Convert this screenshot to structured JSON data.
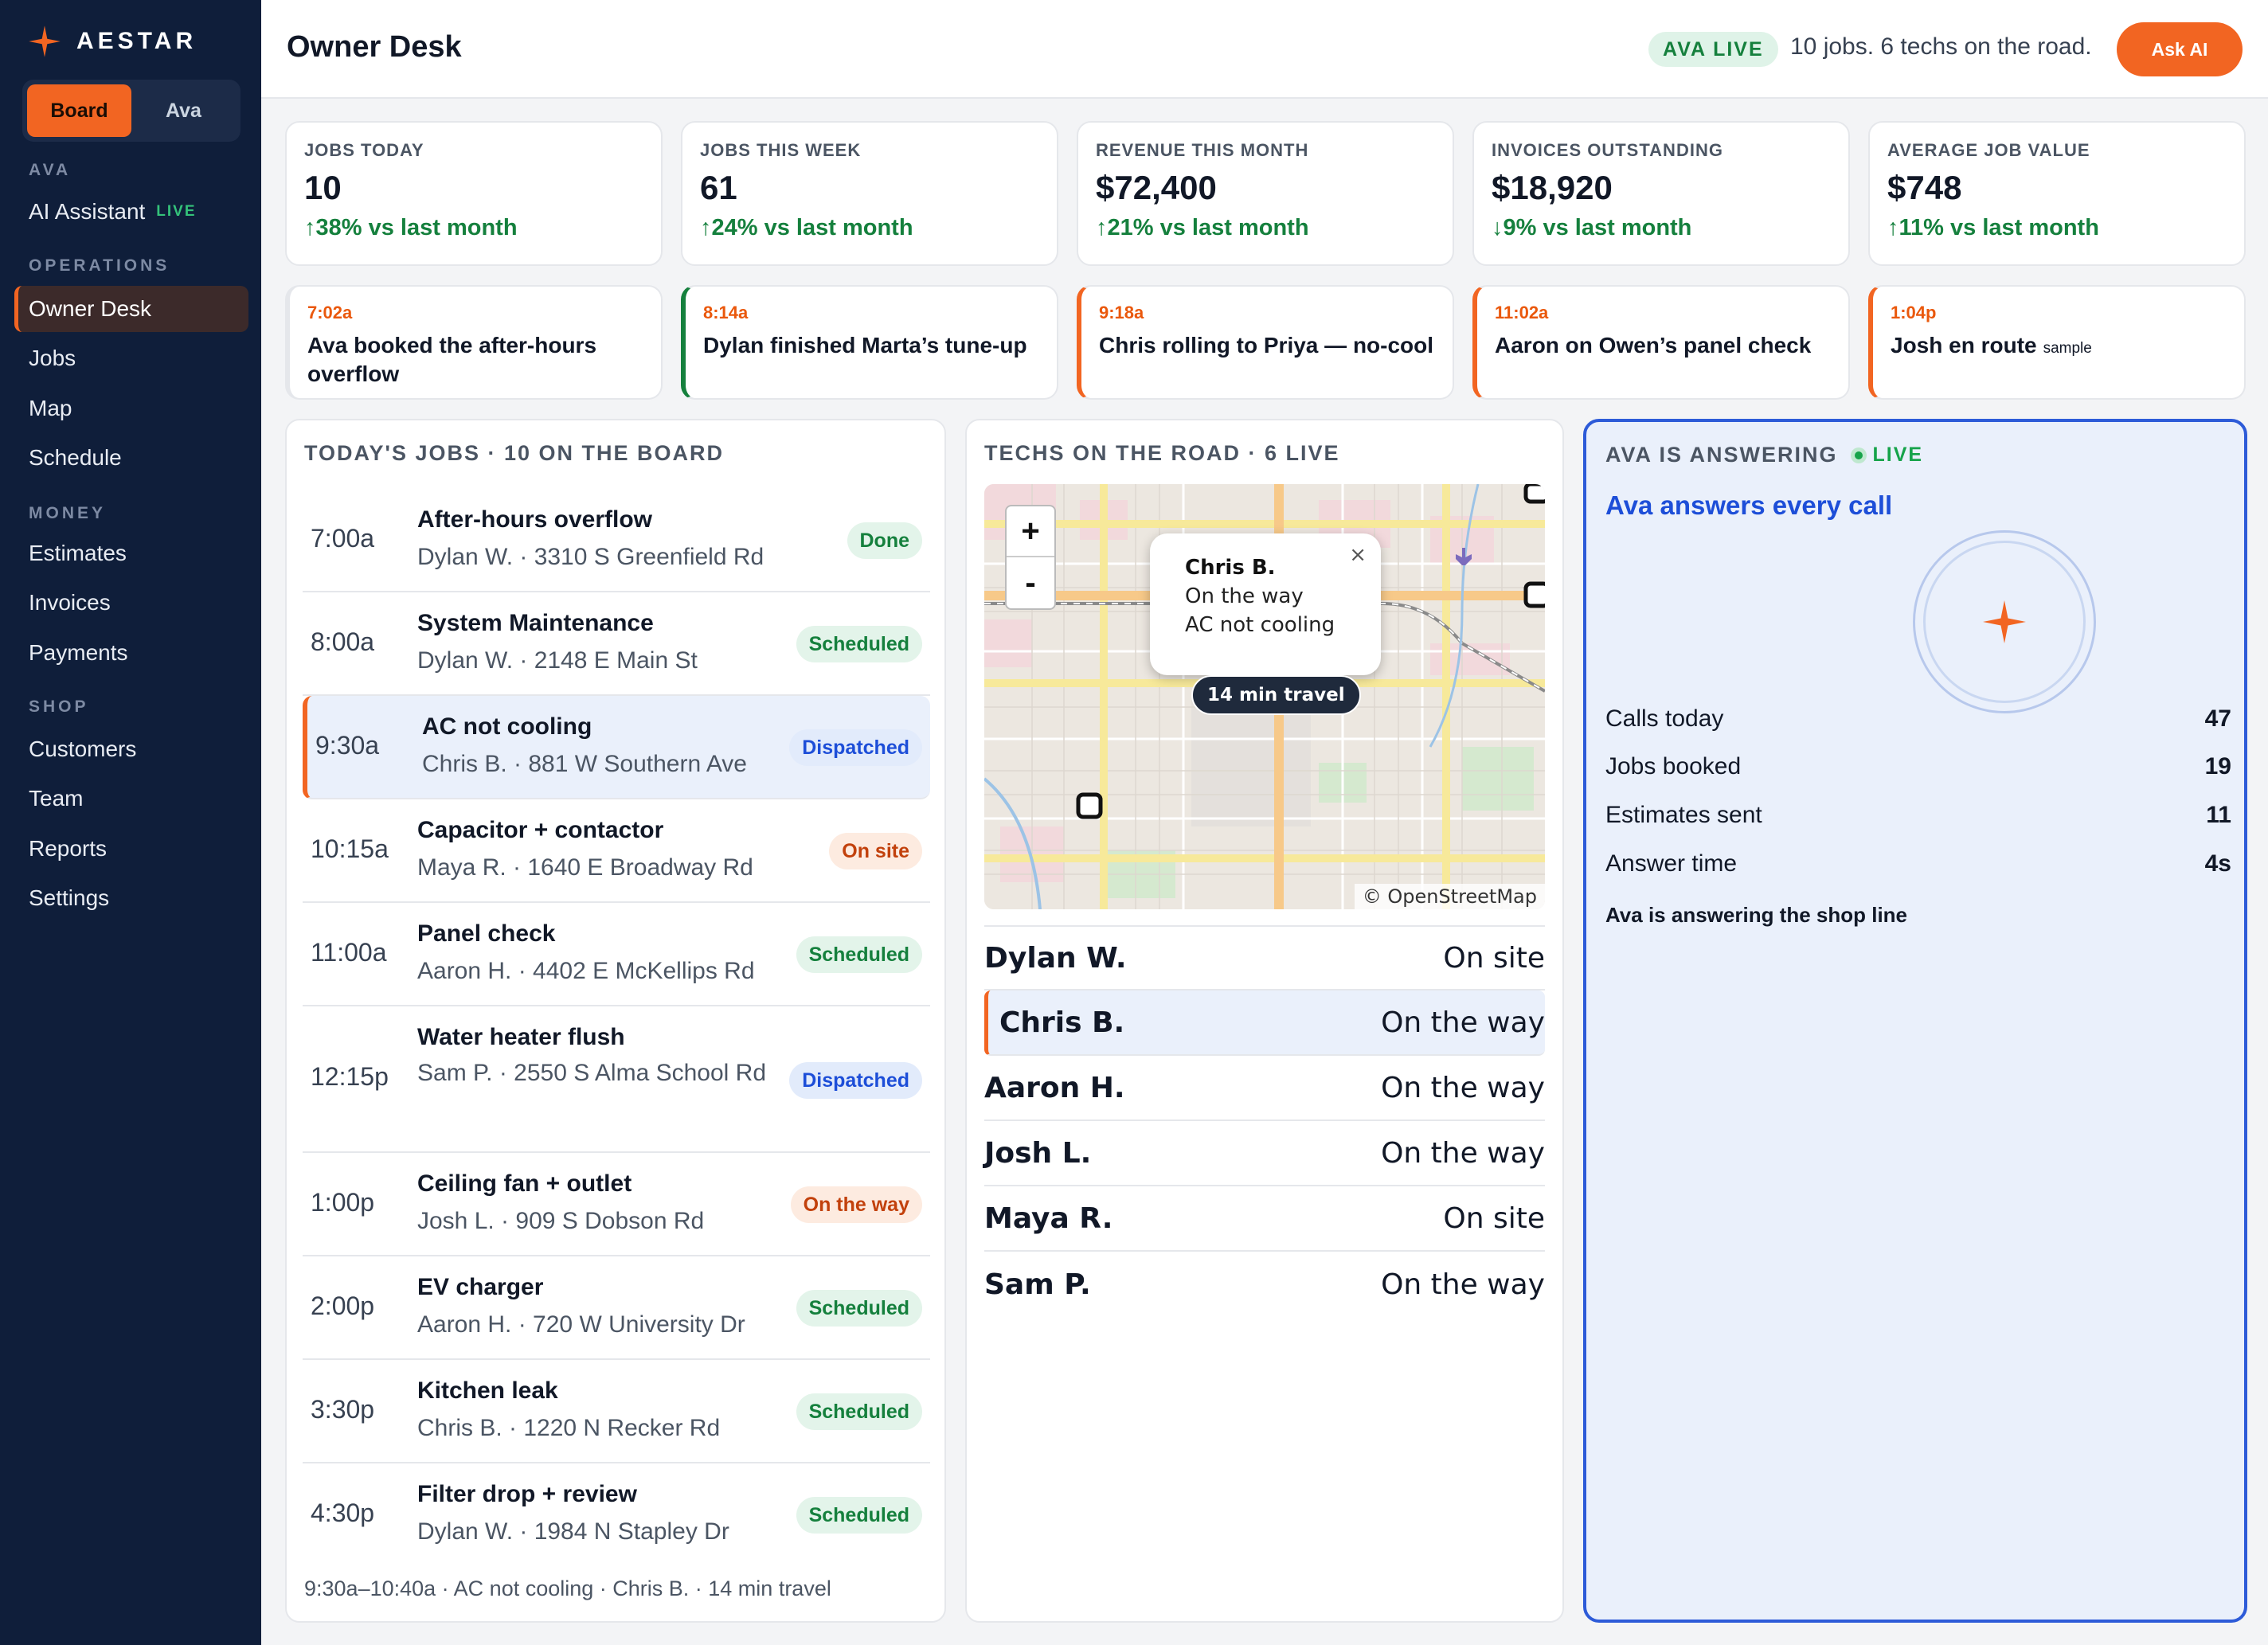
{
  "brand": "AESTAR",
  "toggle": {
    "board": "Board",
    "ava": "Ava"
  },
  "sidebar": {
    "ava_section": "AVA",
    "ai_assistant": "AI Assistant",
    "ai_live": "LIVE",
    "operations_section": "OPERATIONS",
    "owner_desk": "Owner Desk",
    "jobs": "Jobs",
    "map": "Map",
    "schedule": "Schedule",
    "money_section": "MONEY",
    "estimates": "Estimates",
    "invoices": "Invoices",
    "payments": "Payments",
    "shop_section": "SHOP",
    "customers": "Customers",
    "team": "Team",
    "reports": "Reports",
    "settings": "Settings"
  },
  "header": {
    "title": "Owner Desk",
    "ava_live": "AVA LIVE",
    "status": "10 jobs. 6 techs on the road.",
    "ask_button": "Ask AI"
  },
  "stats": [
    {
      "label": "JOBS TODAY",
      "value": "10",
      "change": "↑38% vs last month"
    },
    {
      "label": "JOBS THIS WEEK",
      "value": "61",
      "change": "↑24% vs last month"
    },
    {
      "label": "REVENUE THIS MONTH",
      "value": "$72,400",
      "change": "↑21% vs last month"
    },
    {
      "label": "INVOICES OUTSTANDING",
      "value": "$18,920",
      "change": "↓9% vs last month"
    },
    {
      "label": "AVERAGE JOB VALUE",
      "value": "$748",
      "change": "↑11% vs last month"
    }
  ],
  "feed": [
    {
      "time": "7:02a",
      "text": "Ava booked the after-hours overflow",
      "color": "#ea580c"
    },
    {
      "time": "8:14a",
      "text": "Dylan finished Marta’s tune-up",
      "color": "#15803d"
    },
    {
      "time": "9:18a",
      "text": "Chris rolling to Priya — no-cool",
      "color": "#ea580c"
    },
    {
      "time": "11:02a",
      "text": "Aaron on Owen’s panel check",
      "color": "#ea580c"
    },
    {
      "time": "1:04p",
      "text": "Josh en route",
      "extra": "sample",
      "color": "#ea580c"
    }
  ],
  "jobs_panel": {
    "title": "TODAY'S JOBS · 10 ON THE BOARD",
    "jobs": [
      {
        "time": "7:00a",
        "title": "After-hours overflow",
        "sub": "Dylan W. · 3310 S Greenfield Rd",
        "status": "Done"
      },
      {
        "time": "8:00a",
        "title": "System Maintenance",
        "sub": "Dylan W. · 2148 E Main St",
        "status": "Scheduled"
      },
      {
        "time": "9:30a",
        "title": "AC not cooling",
        "sub": "Chris B. · 881 W Southern Ave",
        "status": "Dispatched"
      },
      {
        "time": "10:15a",
        "title": "Capacitor + contactor",
        "sub": "Maya R. · 1640 E Broadway Rd",
        "status": "On site"
      },
      {
        "time": "11:00a",
        "title": "Panel check",
        "sub": "Aaron H. · 4402 E McKellips Rd",
        "status": "Scheduled"
      },
      {
        "time": "12:15p",
        "title": "Water heater flush",
        "sub": "Sam P. · 2550 S Alma School Rd",
        "status": "Dispatched"
      },
      {
        "time": "1:00p",
        "title": "Ceiling fan + outlet",
        "sub": "Josh L. · 909 S Dobson Rd",
        "status": "On the way"
      },
      {
        "time": "2:00p",
        "title": "EV charger",
        "sub": "Aaron H. · 720 W University Dr",
        "status": "Scheduled"
      },
      {
        "time": "3:30p",
        "title": "Kitchen leak",
        "sub": "Chris B. · 1220 N Recker Rd",
        "status": "Scheduled"
      },
      {
        "time": "4:30p",
        "title": "Filter drop + review",
        "sub": "Dylan W. · 1984 N Stapley Dr",
        "status": "Scheduled"
      }
    ],
    "footer": "9:30a–10:40a · AC not cooling · Chris B. · 14 min travel"
  },
  "techs_panel": {
    "title": "TECHS ON THE ROAD · 6 LIVE",
    "zoom_in": "+",
    "zoom_out": "-",
    "popup": {
      "name": "Chris B.",
      "status": "On the way",
      "job": "AC not cooling",
      "close": "×"
    },
    "travel": "14 min travel",
    "attribution": "© OpenStreetMap",
    "techs": [
      {
        "name": "Dylan W.",
        "status": "On site"
      },
      {
        "name": "Chris B.",
        "status": "On the way"
      },
      {
        "name": "Aaron H.",
        "status": "On the way"
      },
      {
        "name": "Josh L.",
        "status": "On the way"
      },
      {
        "name": "Maya R.",
        "status": "On site"
      },
      {
        "name": "Sam P.",
        "status": "On the way"
      }
    ]
  },
  "ava_panel": {
    "title": "AVA IS ANSWERING",
    "live": "LIVE",
    "heading": "Ava answers every call",
    "metrics": [
      {
        "label": "Calls today",
        "value": "47"
      },
      {
        "label": "Jobs booked",
        "value": "19"
      },
      {
        "label": "Estimates sent",
        "value": "11"
      },
      {
        "label": "Answer time",
        "value": "4s"
      }
    ],
    "footer": "Ava is answering the shop line"
  },
  "colors": {
    "accent": "#f26522",
    "sidebar": "#0f1e3a",
    "ava_border": "#2d5bd8",
    "positive": "#15803d"
  }
}
